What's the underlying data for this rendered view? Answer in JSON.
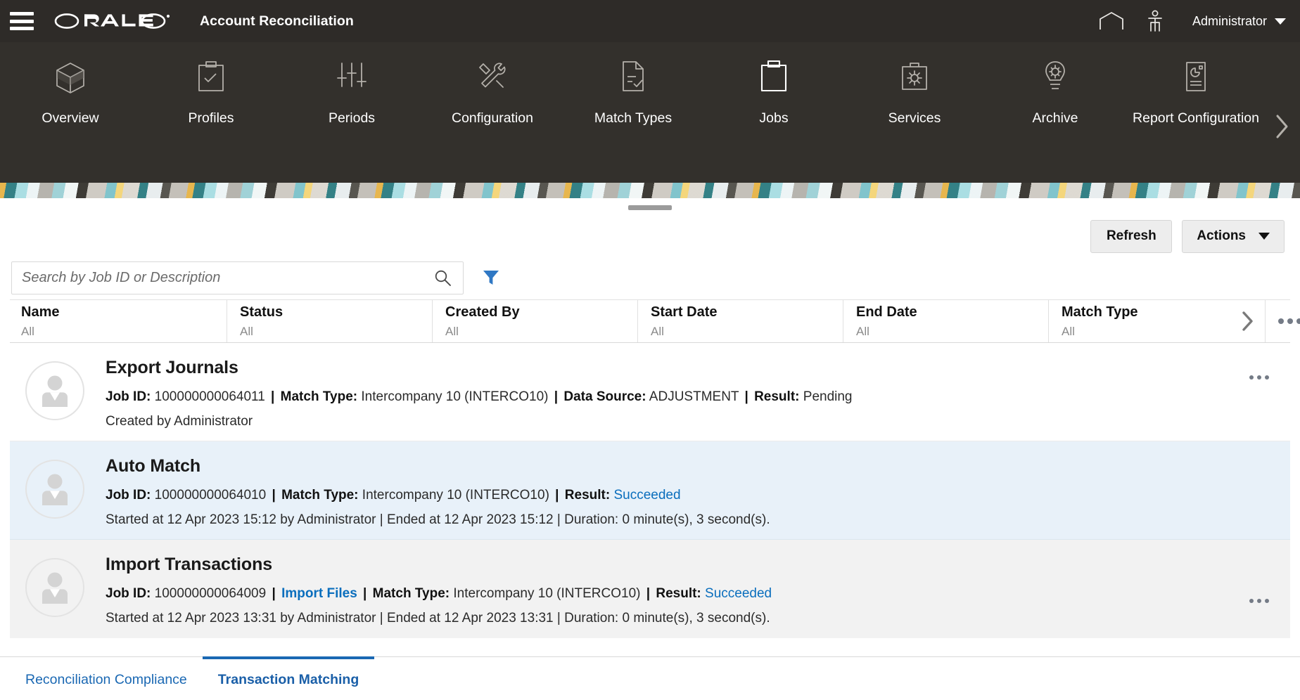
{
  "header": {
    "menu_icon": "hamburger-icon",
    "brand": "ORACLE",
    "app_title": "Account Reconciliation",
    "home_icon": "home-icon",
    "accessibility_icon": "person-icon",
    "user_label": "Administrator",
    "user_caret": "chevron-down-icon",
    "background_color": "#2e2b28"
  },
  "nav": {
    "items": [
      {
        "label": "Overview",
        "icon": "cube-icon",
        "active": false
      },
      {
        "label": "Profiles",
        "icon": "clipboard-check-icon",
        "active": false
      },
      {
        "label": "Periods",
        "icon": "sliders-icon",
        "active": false
      },
      {
        "label": "Configuration",
        "icon": "tools-icon",
        "active": false
      },
      {
        "label": "Match Types",
        "icon": "document-check-icon",
        "active": false
      },
      {
        "label": "Jobs",
        "icon": "clipboard-icon",
        "active": true
      },
      {
        "label": "Services",
        "icon": "toolbox-gear-icon",
        "active": false
      },
      {
        "label": "Archive",
        "icon": "lightbulb-icon",
        "active": false
      },
      {
        "label": "Report Configuration",
        "icon": "report-pie-icon",
        "active": false
      }
    ],
    "next_arrow_icon": "chevron-right-icon"
  },
  "toolbar": {
    "refresh_label": "Refresh",
    "actions_label": "Actions",
    "actions_caret_icon": "caret-down-icon"
  },
  "search": {
    "placeholder": "Search by Job ID or Description",
    "value": "",
    "search_icon": "magnifier-icon",
    "filter_icon": "funnel-filter-icon",
    "filter_color": "#2f78c4"
  },
  "table": {
    "columns": [
      {
        "title": "Name",
        "filter": "All"
      },
      {
        "title": "Status",
        "filter": "All"
      },
      {
        "title": "Created By",
        "filter": "All"
      },
      {
        "title": "Start Date",
        "filter": "All"
      },
      {
        "title": "End Date",
        "filter": "All"
      },
      {
        "title": "Match Type",
        "filter": "All"
      }
    ],
    "expand_icon": "chevron-right-icon",
    "header_more_icon": "ellipsis-icon"
  },
  "jobs": [
    {
      "avatar_icon": "user-avatar-icon",
      "title": "Export Journals",
      "meta": {
        "job_id_label": "Job ID:",
        "job_id": "100000000064011",
        "match_type_label": "Match Type:",
        "match_type": "Intercompany 10 (INTERCO10)",
        "data_source_label": "Data Source:",
        "data_source": "ADJUSTMENT",
        "result_label": "Result:",
        "result": "Pending",
        "result_is_link": false
      },
      "sub": "Created by Administrator",
      "more_icon": "ellipsis-icon",
      "selected": false,
      "alt": false
    },
    {
      "avatar_icon": "user-avatar-icon",
      "title": "Auto Match",
      "meta": {
        "job_id_label": "Job ID:",
        "job_id": "100000000064010",
        "match_type_label": "Match Type:",
        "match_type": "Intercompany 10 (INTERCO10)",
        "result_label": "Result:",
        "result": "Succeeded",
        "result_is_link": true
      },
      "sub": "Started at 12 Apr 2023 15:12 by Administrator  | Ended at 12 Apr 2023 15:12 | Duration: 0 minute(s), 3 second(s).",
      "more_icon": "ellipsis-icon",
      "selected": true,
      "alt": false
    },
    {
      "avatar_icon": "user-avatar-icon",
      "title": "Import Transactions",
      "meta": {
        "job_id_label": "Job ID:",
        "job_id": "100000000064009",
        "import_files_link": "Import Files",
        "match_type_label": "Match Type:",
        "match_type": "Intercompany 10 (INTERCO10)",
        "result_label": "Result:",
        "result": "Succeeded",
        "result_is_link": true
      },
      "sub": "Started at 12 Apr 2023 13:31 by Administrator  | Ended at 12 Apr 2023 13:31 | Duration: 0 minute(s), 3 second(s).",
      "more_icon": "ellipsis-icon",
      "selected": false,
      "alt": true
    }
  ],
  "bottom_tabs": [
    {
      "label": "Reconciliation Compliance",
      "active": false
    },
    {
      "label": "Transaction Matching",
      "active": true
    }
  ],
  "colors": {
    "chrome_dark": "#2e2b28",
    "nav_dark": "#33302c",
    "link_blue": "#0a6ebd",
    "tab_blue": "#1a68b3",
    "selected_row": "#e8f1f9",
    "alt_row": "#f2f2f2"
  }
}
